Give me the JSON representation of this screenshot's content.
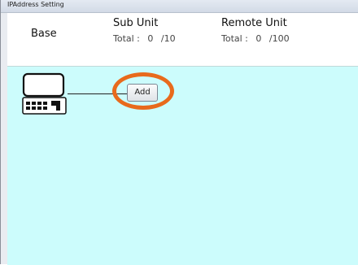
{
  "window": {
    "title": "IPAddress Setting"
  },
  "header": {
    "base_label": "Base",
    "sub_unit": {
      "label": "Sub Unit",
      "total_label": "Total :",
      "count": "0",
      "max": "/10"
    },
    "remote_unit": {
      "label": "Remote Unit",
      "total_label": "Total :",
      "count": "0",
      "max": "/100"
    }
  },
  "canvas": {
    "background": "#ccfcfc",
    "base_device_icon": "base-unit-icon",
    "add_button_label": "Add",
    "highlight_color": "#e86a1c"
  }
}
